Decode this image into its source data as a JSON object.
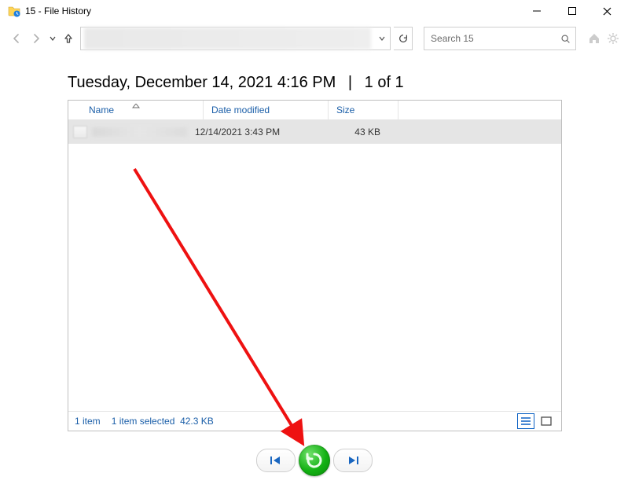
{
  "window": {
    "title": "15 - File History"
  },
  "search": {
    "placeholder": "Search 15"
  },
  "heading": {
    "timestamp": "Tuesday, December 14, 2021 4:16 PM",
    "index": "1 of 1"
  },
  "columns": {
    "name": "Name",
    "date_modified": "Date modified",
    "size": "Size"
  },
  "files": [
    {
      "date_modified": "12/14/2021 3:43 PM",
      "size": "43 KB",
      "selected": true
    }
  ],
  "status": {
    "count": "1 item",
    "selection": "1 item selected",
    "selection_size": "42.3 KB"
  }
}
